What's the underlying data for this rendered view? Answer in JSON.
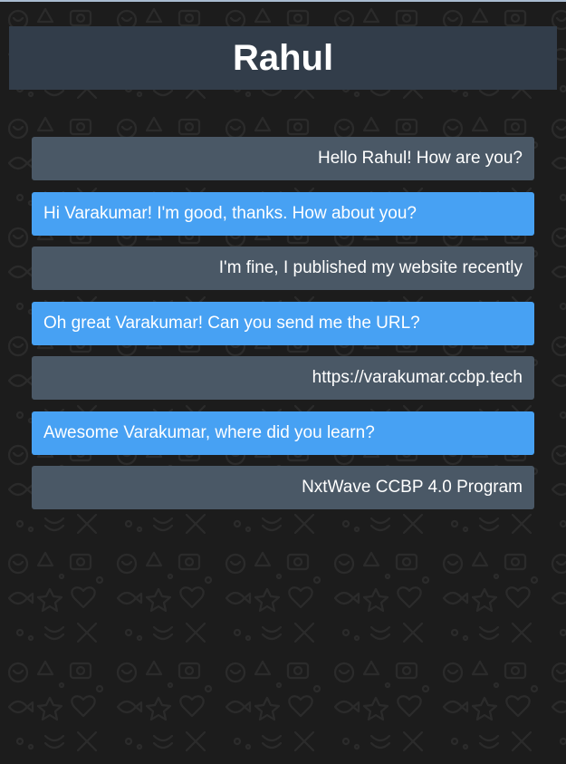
{
  "header": {
    "title": "Rahul"
  },
  "messages": [
    {
      "text": "Hello Rahul! How are you?",
      "direction": "sent"
    },
    {
      "text": "Hi Varakumar! I'm good, thanks. How about you?",
      "direction": "received"
    },
    {
      "text": "I'm fine, I published my website recently",
      "direction": "sent"
    },
    {
      "text": "Oh great Varakumar! Can you send me the URL?",
      "direction": "received"
    },
    {
      "text": "https://varakumar.ccbp.tech",
      "direction": "sent"
    },
    {
      "text": "Awesome Varakumar, where did you learn?",
      "direction": "received"
    },
    {
      "text": "NxtWave CCBP 4.0 Program",
      "direction": "sent"
    }
  ],
  "colors": {
    "background": "#1c1c1c",
    "header": "#323d4a",
    "sent_bubble": "#4a5866",
    "received_bubble": "#47a1f3",
    "text": "#ffffff"
  }
}
